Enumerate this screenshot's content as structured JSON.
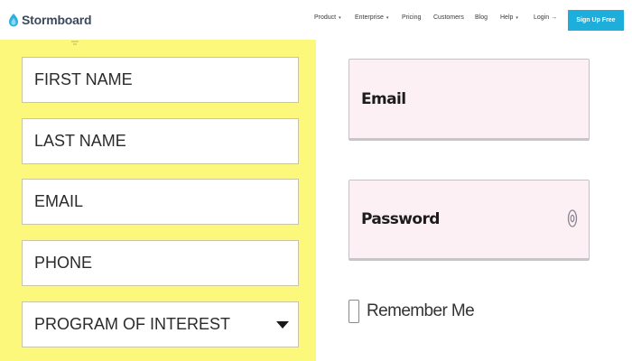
{
  "header": {
    "logo_text": "Stormboard",
    "nav": [
      {
        "label": "Product",
        "dropdown": true
      },
      {
        "label": "Enterprise",
        "dropdown": true
      },
      {
        "label": "Pricing",
        "dropdown": false
      },
      {
        "label": "Customers",
        "dropdown": false
      },
      {
        "label": "Blog",
        "dropdown": false
      },
      {
        "label": "Help",
        "dropdown": true
      },
      {
        "label": "Login →",
        "dropdown": false
      }
    ],
    "caret": "▾",
    "signup_label": "Sign Up Free",
    "accent_color": "#1eaedb"
  },
  "lead_form": {
    "background_color": "#fbf87c",
    "fields": [
      {
        "placeholder": "FIRST NAME"
      },
      {
        "placeholder": "LAST NAME"
      },
      {
        "placeholder": "EMAIL"
      },
      {
        "placeholder": "PHONE"
      },
      {
        "placeholder": "PROGRAM OF INTEREST",
        "type": "select"
      }
    ]
  },
  "login_form": {
    "field_background": "#fdf0f4",
    "email_placeholder": "Email",
    "password_placeholder": "Password",
    "password_icon": "eye-icon",
    "remember_label": "Remember Me",
    "remember_checked": false
  }
}
